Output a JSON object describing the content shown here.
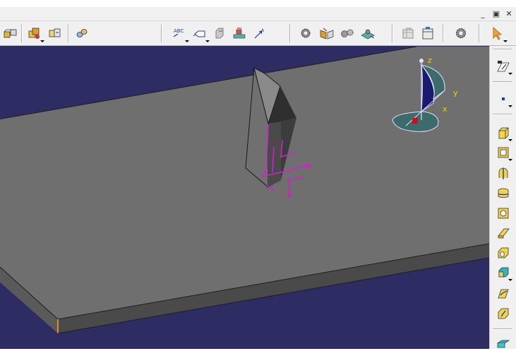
{
  "window": {
    "minimize_label": "_",
    "restore_label": "▣",
    "close_label": "✕"
  },
  "toolbar": {
    "groups": [
      [
        "assembly-icon"
      ],
      [
        "product-icon",
        "component-icon"
      ],
      [
        "constraint-icon"
      ],
      [
        "text-abc-icon",
        "flag-note-icon",
        "datum-icon",
        "dimension-icon",
        "arrow-dimension-icon"
      ],
      [
        "settings-gear-icon",
        "open-book-icon",
        "gears-icon",
        "stamp-icon"
      ],
      [
        "table-icon",
        "frame-icon"
      ],
      [
        "tools-gear-icon"
      ],
      [
        "select-cursor-icon"
      ]
    ]
  },
  "viewport": {
    "background": "#2d2d64",
    "compass": {
      "z_label": "z",
      "y_label": "y",
      "x_label": "x",
      "label_color": "#e8d800"
    }
  },
  "right_toolbar": {
    "icons": [
      "sketch-icon",
      "point-icon",
      "pad-icon",
      "pocket-icon",
      "shaft-icon",
      "groove-icon",
      "hole-icon",
      "rib-icon",
      "slot-icon",
      "multi-pad-icon",
      "loft-icon",
      "stiffener-icon",
      "solid-combine-icon"
    ]
  }
}
